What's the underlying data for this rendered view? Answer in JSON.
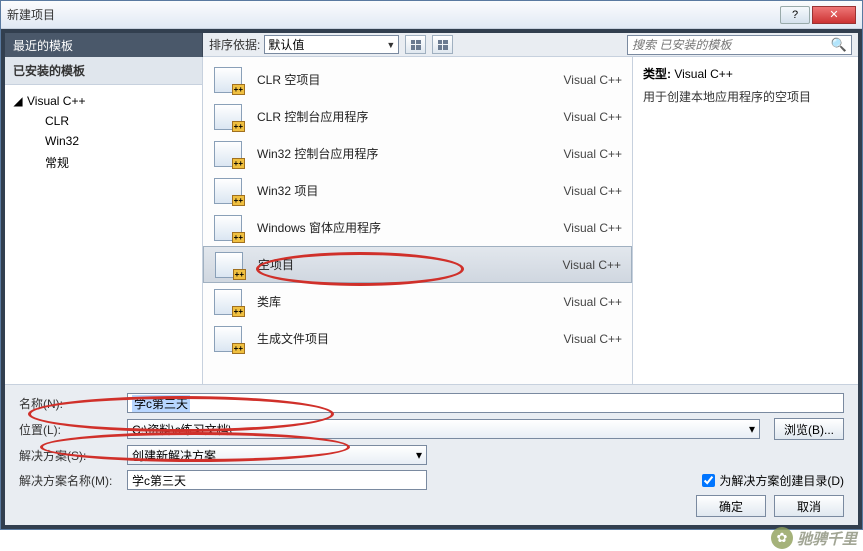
{
  "window": {
    "title": "新建项目"
  },
  "sidebar": {
    "recent_header": "最近的模板",
    "installed_header": "已安装的模板",
    "root_item": "Visual C++",
    "children": [
      "CLR",
      "Win32",
      "常规"
    ]
  },
  "sortbar": {
    "label": "排序依据:",
    "value": "默认值"
  },
  "search": {
    "placeholder": "搜索 已安装的模板"
  },
  "templates": [
    {
      "name": "CLR 空项目",
      "lang": "Visual C++",
      "selected": false
    },
    {
      "name": "CLR 控制台应用程序",
      "lang": "Visual C++",
      "selected": false
    },
    {
      "name": "Win32 控制台应用程序",
      "lang": "Visual C++",
      "selected": false
    },
    {
      "name": "Win32 项目",
      "lang": "Visual C++",
      "selected": false
    },
    {
      "name": "Windows 窗体应用程序",
      "lang": "Visual C++",
      "selected": false
    },
    {
      "name": "空项目",
      "lang": "Visual C++",
      "selected": true
    },
    {
      "name": "类库",
      "lang": "Visual C++",
      "selected": false
    },
    {
      "name": "生成文件项目",
      "lang": "Visual C++",
      "selected": false
    }
  ],
  "details": {
    "type_label": "类型:",
    "type_value": "Visual C++",
    "description": "用于创建本地应用程序的空项目"
  },
  "form": {
    "name_label": "名称(N):",
    "name_value": "学c第三天",
    "location_label": "位置(L):",
    "location_value": "C:\\资料\\c练习文档\\",
    "solution_label": "解决方案(S):",
    "solution_value": "创建新解决方案",
    "solname_label": "解决方案名称(M):",
    "solname_value": "学c第三天",
    "browse_btn": "浏览(B)...",
    "createdir_label": "为解决方案创建目录(D)",
    "createdir_checked": true
  },
  "buttons": {
    "ok": "确定",
    "cancel": "取消"
  },
  "watermark": "驰骋千里"
}
